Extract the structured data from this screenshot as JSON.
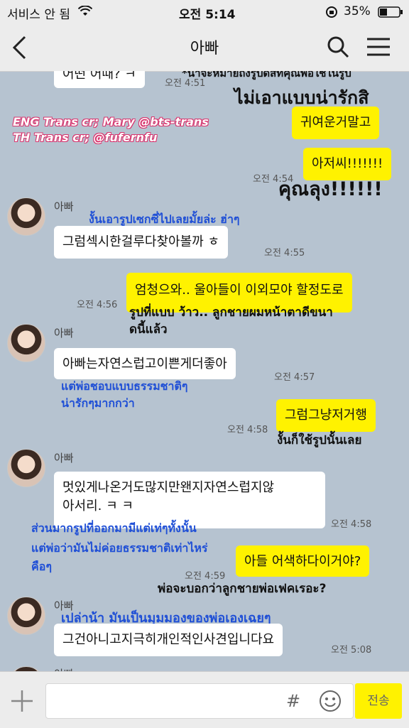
{
  "status": {
    "carrier": "서비스 안 됨",
    "time": "오전 5:14",
    "battery": "35%"
  },
  "header": {
    "title": "아빠"
  },
  "credits": {
    "line1": "ENG Trans cr; Mary @bts-trans",
    "line2": "TH Trans cr; @fufernfu"
  },
  "messages": [
    {
      "kind": "in",
      "text": "어떤 어때? ㅋ",
      "time": "오전 4:51"
    },
    {
      "kind": "note",
      "text": "*น่าจะหมายถึงรูปดิสที่คุณพ่อใช้ในรูป"
    },
    {
      "kind": "note",
      "text": "ไม่เอาแบบน่ารักสิ"
    },
    {
      "kind": "out",
      "text": "귀여운거말고"
    },
    {
      "kind": "out",
      "text": "아저씨!!!!!!!",
      "time": "오전 4:54"
    },
    {
      "kind": "note",
      "text": "คุณลุง!!!!!!"
    },
    {
      "kind": "in",
      "sender": "아빠",
      "text": "그럼섹시한걸루다찾아볼까 ㅎ",
      "time": "오전 4:55",
      "translation": "งั้นเอารูปเซกซี่ไปเลยมั้ยล่ะ ฮ่าๆ"
    },
    {
      "kind": "out",
      "text": "엄청으와.. 울아들이 이외모야 할정도로",
      "time": "오전 4:56",
      "translation1": "รูปที่แบบ ว้าว.. ลูกชายผมหน้าตาดีขนา",
      "translation2": "ดนี้แล้ว"
    },
    {
      "kind": "in",
      "sender": "아빠",
      "text": "아빠는자연스럽고이쁜게더좋아",
      "time": "오전 4:57",
      "translation1": "แต่พ่อชอบแบบธรรมชาติๆ",
      "translation2": "น่ารักๆมากกว่า"
    },
    {
      "kind": "out",
      "text": "그럼그냥저거행",
      "time": "오전 4:58",
      "translation": "งั้นก็ใช้รูปนั้นเลย"
    },
    {
      "kind": "in",
      "sender": "아빠",
      "text1": "멋있게나온거도많지만왠지자연스럽지않",
      "text2": "아서리. ㅋ ㅋ",
      "time": "오전 4:58",
      "translation1": "ส่วนมากรูปที่ออกมามีแต่เท่ๆทั้งนั้น",
      "translation2": "แต่พ่อว่ามันไม่ค่อยธรรมชาติเท่าไหร่",
      "translation3": "คือๆ"
    },
    {
      "kind": "out",
      "text": "아들 어색하다이거야?",
      "time": "오전 4:59",
      "translation": "พ่อจะบอกว่าลูกชายพ่อเฟคเรอะ?"
    },
    {
      "kind": "in",
      "sender": "아빠",
      "text": "그건아니고지극히개인적인사견입니다요",
      "time": "오전 5:08",
      "translation": "เปล่าน้า มันเป็นมุมมองของพ่อเองเฉยๆ"
    }
  ],
  "input": {
    "hash_icon": "#",
    "send_label": "전송"
  },
  "colors": {
    "chat_bg": "#b6c3d0",
    "out_bubble": "#fff200",
    "in_bubble": "#ffffff",
    "translation_blue": "#1f4fd6",
    "credit_pink": "#d8346e"
  },
  "icons": [
    "back-icon",
    "search-icon",
    "menu-icon",
    "wifi-icon",
    "lock-rotation-icon",
    "battery-icon",
    "plus-icon",
    "emoji-icon"
  ]
}
